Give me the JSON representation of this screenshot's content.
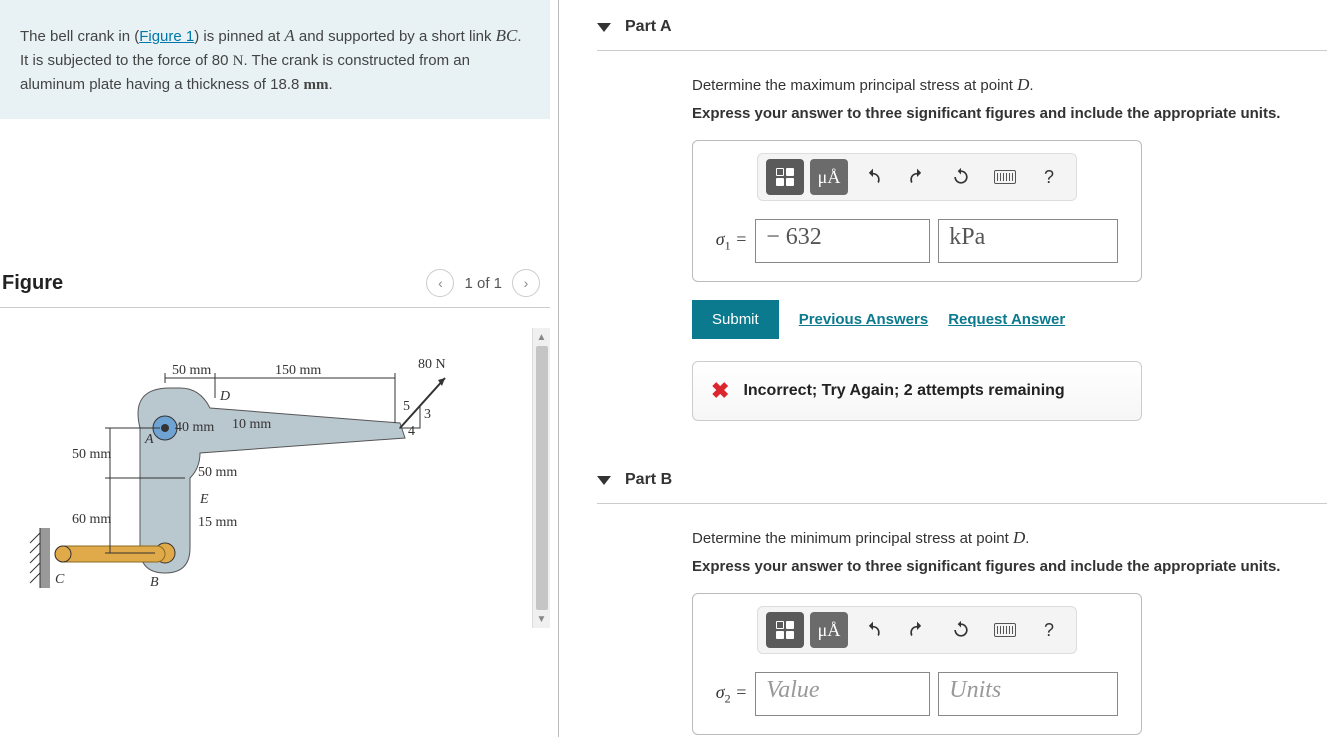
{
  "problem": {
    "text_before_link": "The bell crank in (",
    "figure_link": "Figure 1",
    "text_after_link": ") is pinned at ",
    "var_A": "A",
    "text_mid1": " and supported by a short link ",
    "var_BC": "BC",
    "text_mid2": ". It is subjected to the force of 80 ",
    "unit_N": "N",
    "text_mid3": ". The crank is constructed from an aluminum plate having a thickness of 18.8 ",
    "unit_mm": "mm",
    "text_end": "."
  },
  "figure": {
    "title": "Figure",
    "page_indicator": "1 of 1",
    "labels": {
      "force": "80 N",
      "d50a": "50 mm",
      "d150": "150 mm",
      "D": "D",
      "d40": "40 mm",
      "d10": "10 mm",
      "d50b": "50 mm",
      "A": "A",
      "d50c": "50 mm",
      "E": "E",
      "d60": "60 mm",
      "d15": "15 mm",
      "C": "C",
      "B": "B",
      "t3": "3",
      "t4": "4",
      "t5": "5"
    }
  },
  "partA": {
    "title": "Part A",
    "instruction_pre": "Determine the maximum principal stress at point ",
    "instruction_var": "D",
    "instruction_post": ".",
    "bold_instruction": "Express your answer to three significant figures and include the appropriate units.",
    "sigma_label": "σ",
    "sigma_sub": "1",
    "equals": " = ",
    "value": "− 632",
    "units": "kPa",
    "submit": "Submit",
    "prev_answers": "Previous Answers",
    "request_answer": "Request Answer",
    "feedback": "Incorrect; Try Again; 2 attempts remaining"
  },
  "partB": {
    "title": "Part B",
    "instruction_pre": "Determine the minimum principal stress at point ",
    "instruction_var": "D",
    "instruction_post": ".",
    "bold_instruction": "Express your answer to three significant figures and include the appropriate units.",
    "sigma_label": "σ",
    "sigma_sub": "2",
    "equals": " = ",
    "value_placeholder": "Value",
    "units_placeholder": "Units"
  },
  "toolbar": {
    "units_btn": "μÅ",
    "help": "?"
  }
}
